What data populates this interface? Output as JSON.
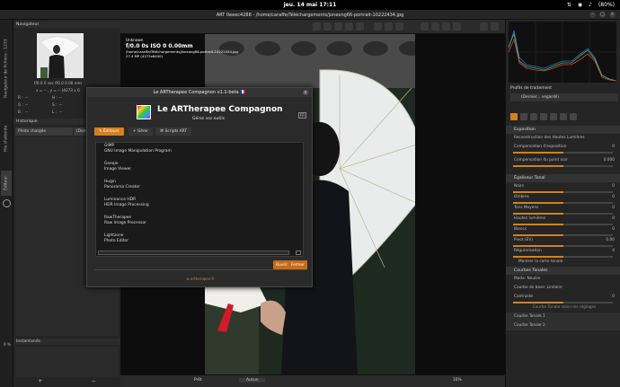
{
  "system": {
    "clock": "jeu. 14 mai  17:11",
    "battery": "(80%)"
  },
  "window": {
    "title": "ART 0eeec4288 - /home/caraffe/Téléchargements/joneong66-portrait-10222434.jpg"
  },
  "left_tabs": [
    "Navigateur de fichiers : 1233",
    "File d'attente",
    "Éditeur"
  ],
  "navigator": {
    "title": "Navigateur",
    "readout": "f/0.0  0 sec  f/0.0  0.00 mm",
    "dims": "x = -- , y = --  (4273 x 6",
    "rows": [
      {
        "k": "R :",
        "v": "--",
        "k2": "H :",
        "v2": "--"
      },
      {
        "k": "G :",
        "v": "--",
        "k2": "S :",
        "v2": "--"
      },
      {
        "k": "B :",
        "v": "--",
        "k2": "L :",
        "v2": "--"
      }
    ]
  },
  "history": {
    "title": "Historique",
    "col1": "Photo chargée",
    "col2": "(Derni"
  },
  "snapshots": {
    "title": "Instantanés",
    "add": "+",
    "remove": "−",
    "zoom": "0 %"
  },
  "image_info": {
    "camera": "Unknown",
    "exposure": "f/0.0  0s  ISO 0  0.00mm",
    "path": "/home/caraffe/Téléchargements/joneong66-portrait-10222434.jpg",
    "size": "27.4 MP (4273x6400)"
  },
  "bottombar": {
    "ready": "Prêt",
    "none": "Aucun",
    "zoom": "16%"
  },
  "right": {
    "profiles_title": "Profils de traitement",
    "profile_value": "(Dernier... vegardé)",
    "exposure_section": "Exposition",
    "highlight_recon": "Reconstruction des Hautes Lumières",
    "comp_expo": {
      "label": "Compensation d'exposition",
      "value": "0"
    },
    "comp_black": {
      "label": "Compensation du point noir",
      "value": "0.000"
    },
    "tone_eq_section": "Égaliseur Tonal",
    "tone_rows": [
      {
        "label": "Noirs",
        "value": "0"
      },
      {
        "label": "Ombres",
        "value": "0"
      },
      {
        "label": "Tons Moyens",
        "value": "0"
      },
      {
        "label": "Hautes lumières",
        "value": "0"
      },
      {
        "label": "Blancs",
        "value": "0"
      },
      {
        "label": "Pivot (EV)",
        "value": "0.00"
      },
      {
        "label": "Régularisation",
        "value": "4"
      }
    ],
    "show_map": "Montrer la carte tonale",
    "curves_section": "Courbes Tonales",
    "mode": {
      "label": "Mode:",
      "value": "Neutre"
    },
    "base_curve": {
      "label": "Courbe de base:",
      "value": "Linéaire"
    },
    "contrast": {
      "label": "Contraste",
      "value": "0"
    },
    "tone_curve_hint": "Courbe Tonale selon les réglages",
    "curve1": "Courbe Tonale 1",
    "curve2": "Courbe Tonale 2"
  },
  "dialog": {
    "title": "Le ARTherapee Compagnon v1.1-beta 🇫🇷",
    "heading": "Le ARTherapee Compagnon",
    "subheading": "Gérez vos outils",
    "lang": "FR",
    "tabs": [
      "Éditeurs",
      "Gérer",
      "Scripts ART"
    ],
    "items": [
      {
        "name": "GIMP",
        "desc": "GNU Image Manipulation Program"
      },
      {
        "name": "Geeqie",
        "desc": "Image Viewer"
      },
      {
        "name": "Hugin",
        "desc": "Panorama Creator"
      },
      {
        "name": "Luminance HDR",
        "desc": "HDR Image Processing"
      },
      {
        "name": "RawTherapee",
        "desc": "Raw Image Processor"
      },
      {
        "name": "Lightzone",
        "desc": "Photo Editor"
      }
    ],
    "open_btn": "Ouvrir",
    "close_btn": "Fermer",
    "footer": "⊛ artherapee.fr"
  },
  "colors": {
    "accent": "#d4801e",
    "button": "#c56b1a"
  }
}
